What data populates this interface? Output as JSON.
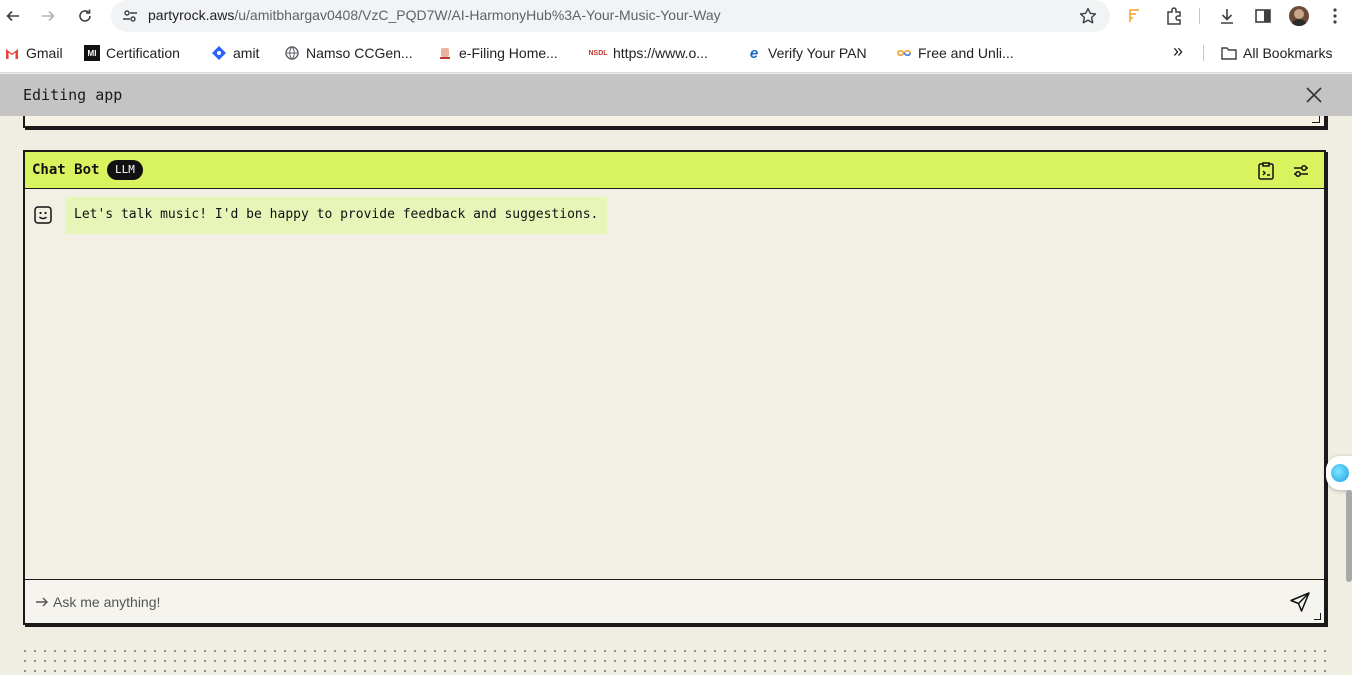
{
  "browser": {
    "url_host": "partyrock.aws",
    "url_path": "/u/amitbhargav0408/VzC_PQD7W/AI-HarmonyHub%3A-Your-Music-Your-Way",
    "bookmarks": [
      {
        "label": "Gmail",
        "icon": "gmail-icon"
      },
      {
        "label": "Certification",
        "icon": "certification-icon"
      },
      {
        "label": "amit",
        "icon": "diamond-icon"
      },
      {
        "label": "Namso CCGen...",
        "icon": "globe-icon"
      },
      {
        "label": "e-Filing Home...",
        "icon": "emblem-icon"
      },
      {
        "label": "https://www.o...",
        "icon": "nsdl-icon"
      },
      {
        "label": "Verify Your PAN",
        "icon": "e-icon"
      },
      {
        "label": "Free and Unli...",
        "icon": "infinity-icon"
      }
    ],
    "all_bookmarks_label": "All Bookmarks",
    "overflow_label": "»"
  },
  "app": {
    "header_title": "Editing app"
  },
  "chat_widget": {
    "title": "Chat Bot",
    "badge": "LLM",
    "bot_message": "Let's talk music! I'd be happy to provide feedback and suggestions.",
    "input_placeholder": "Ask me anything!",
    "accent_color": "#d9f35e",
    "bubble_color": "#e7f6b8"
  }
}
